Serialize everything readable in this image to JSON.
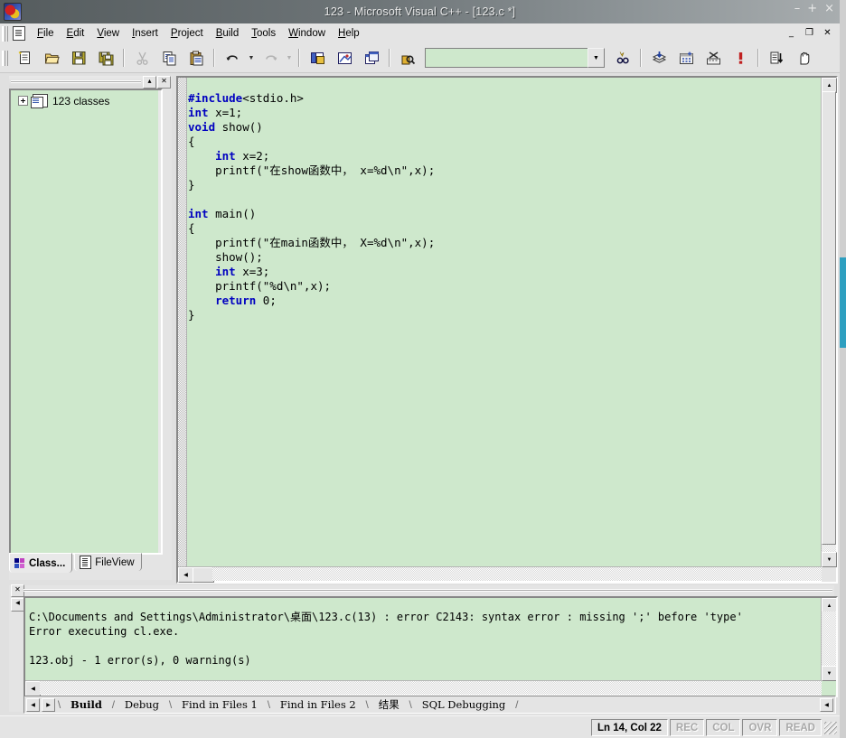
{
  "window": {
    "title": "123 - Microsoft Visual C++ - [123.c *]",
    "app_icon": "visual-cpp-icon",
    "buttons": {
      "minimize": "–",
      "maximize": "+",
      "close": "×"
    }
  },
  "mdi_buttons": {
    "minimize": "_",
    "restore": "❐",
    "close": "✕"
  },
  "menubar": {
    "doc_icon": "document-icon",
    "items": [
      {
        "pre": "",
        "accel": "F",
        "post": "ile"
      },
      {
        "pre": "",
        "accel": "E",
        "post": "dit"
      },
      {
        "pre": "",
        "accel": "V",
        "post": "iew"
      },
      {
        "pre": "",
        "accel": "I",
        "post": "nsert"
      },
      {
        "pre": "",
        "accel": "P",
        "post": "roject"
      },
      {
        "pre": "",
        "accel": "B",
        "post": "uild"
      },
      {
        "pre": "",
        "accel": "T",
        "post": "ools"
      },
      {
        "pre": "",
        "accel": "W",
        "post": "indow"
      },
      {
        "pre": "",
        "accel": "H",
        "post": "elp"
      }
    ]
  },
  "toolbar": {
    "buttons": [
      {
        "name": "new-file-button",
        "glyph": "🗋",
        "title": "New"
      },
      {
        "name": "open-file-button",
        "glyph": "📂",
        "title": "Open"
      },
      {
        "name": "save-button",
        "glyph": "💾",
        "title": "Save"
      },
      {
        "name": "save-all-button",
        "glyph": "🖫",
        "title": "Save All"
      },
      {
        "name": "cut-button",
        "glyph": "✂",
        "title": "Cut"
      },
      {
        "name": "copy-button",
        "glyph": "⧉",
        "title": "Copy"
      },
      {
        "name": "paste-button",
        "glyph": "📋",
        "title": "Paste"
      },
      {
        "name": "undo-button",
        "glyph": "↶",
        "title": "Undo"
      },
      {
        "name": "redo-button",
        "glyph": "↷",
        "title": "Redo"
      },
      {
        "name": "workspace-toggle-button",
        "glyph": "◧",
        "title": "Workspace"
      },
      {
        "name": "output-toggle-button",
        "glyph": "▤",
        "title": "Output"
      },
      {
        "name": "window-list-button",
        "glyph": "❐",
        "title": "Windows"
      },
      {
        "name": "find-in-files-button",
        "glyph": "🔎",
        "title": "Find in Files"
      },
      {
        "name": "search-button",
        "glyph": "🔍",
        "title": "Find"
      },
      {
        "name": "compile-button",
        "glyph": "⬇",
        "title": "Compile"
      },
      {
        "name": "build-button",
        "glyph": "▦",
        "title": "Build"
      },
      {
        "name": "stop-build-button",
        "glyph": "✖",
        "title": "Stop Build"
      },
      {
        "name": "execute-button",
        "glyph": "!",
        "title": "Execute Program"
      },
      {
        "name": "go-button",
        "glyph": "≣",
        "title": "Go"
      },
      {
        "name": "insert-breakpoint-button",
        "glyph": "✋",
        "title": "Insert/Remove Breakpoint"
      }
    ],
    "search_combo": {
      "value": "",
      "placeholder": "",
      "dropdown_icon": "chevron-down-icon"
    }
  },
  "workspace": {
    "caption_buttons": {
      "minimize": "▴",
      "close": "✕"
    },
    "tree": {
      "expand_icon": "plus-box-icon",
      "node_icon": "classes-folder-icon",
      "root_label": "123 classes"
    },
    "tabs": [
      {
        "label": "Class...",
        "icon": "classview-icon",
        "active": true
      },
      {
        "label": "FileView",
        "icon": "fileview-icon",
        "active": false
      }
    ]
  },
  "editor": {
    "filename": "123.c",
    "code_lines": [
      [
        {
          "t": "#include",
          "c": "pp"
        },
        {
          "t": "<stdio.h>",
          "c": ""
        }
      ],
      [
        {
          "t": "int",
          "c": "kw"
        },
        {
          "t": " x=1;",
          "c": ""
        }
      ],
      [
        {
          "t": "void",
          "c": "kw"
        },
        {
          "t": " show()",
          "c": ""
        }
      ],
      [
        {
          "t": "{",
          "c": ""
        }
      ],
      [
        {
          "t": "    ",
          "c": ""
        },
        {
          "t": "int",
          "c": "kw"
        },
        {
          "t": " x=2;",
          "c": ""
        }
      ],
      [
        {
          "t": "    printf(\"在show函数中， x=%d\\n\",x);",
          "c": ""
        }
      ],
      [
        {
          "t": "}",
          "c": ""
        }
      ],
      [
        {
          "t": "",
          "c": ""
        }
      ],
      [
        {
          "t": "int",
          "c": "kw"
        },
        {
          "t": " main()",
          "c": ""
        }
      ],
      [
        {
          "t": "{",
          "c": ""
        }
      ],
      [
        {
          "t": "    printf(\"在main函数中， X=%d\\n\",x);",
          "c": ""
        }
      ],
      [
        {
          "t": "    show();",
          "c": ""
        }
      ],
      [
        {
          "t": "    ",
          "c": ""
        },
        {
          "t": "int",
          "c": "kw"
        },
        {
          "t": " x=3;",
          "c": ""
        }
      ],
      [
        {
          "t": "    printf(\"%d\\n\",x);",
          "c": ""
        }
      ],
      [
        {
          "t": "    ",
          "c": ""
        },
        {
          "t": "return",
          "c": "kw"
        },
        {
          "t": " 0;",
          "c": ""
        }
      ],
      [
        {
          "t": "}",
          "c": ""
        }
      ]
    ],
    "scroll": {
      "up_arrow": "▲",
      "down_arrow": "▼",
      "left_arrow": "◀",
      "right_arrow": "▶"
    }
  },
  "output": {
    "close_button": "✕",
    "left_button": "◀",
    "text": "C:\\Documents and Settings\\Administrator\\桌面\\123.c(13) : error C2143: syntax error : missing ';' before 'type'\nError executing cl.exe.\n\n123.obj - 1 error(s), 0 warning(s)",
    "tabs": [
      {
        "label": "Build",
        "active": true
      },
      {
        "label": "Debug",
        "active": false
      },
      {
        "label": "Find in Files 1",
        "active": false
      },
      {
        "label": "Find in Files 2",
        "active": false
      },
      {
        "label": "结果",
        "active": false
      },
      {
        "label": "SQL Debugging",
        "active": false
      }
    ],
    "tab_nav": {
      "left": "◀",
      "right": "▶",
      "scroll_right": "◀"
    }
  },
  "statusbar": {
    "message": "",
    "position": "Ln 14, Col 22",
    "indicators": [
      "REC",
      "COL",
      "OVR",
      "READ"
    ]
  },
  "colors": {
    "editor_background": "#cee8cc",
    "keyword": "#0000c0",
    "chrome": "#e4e4e4",
    "titlebar": "#6e7578",
    "desktop": "#2e9fc0"
  }
}
